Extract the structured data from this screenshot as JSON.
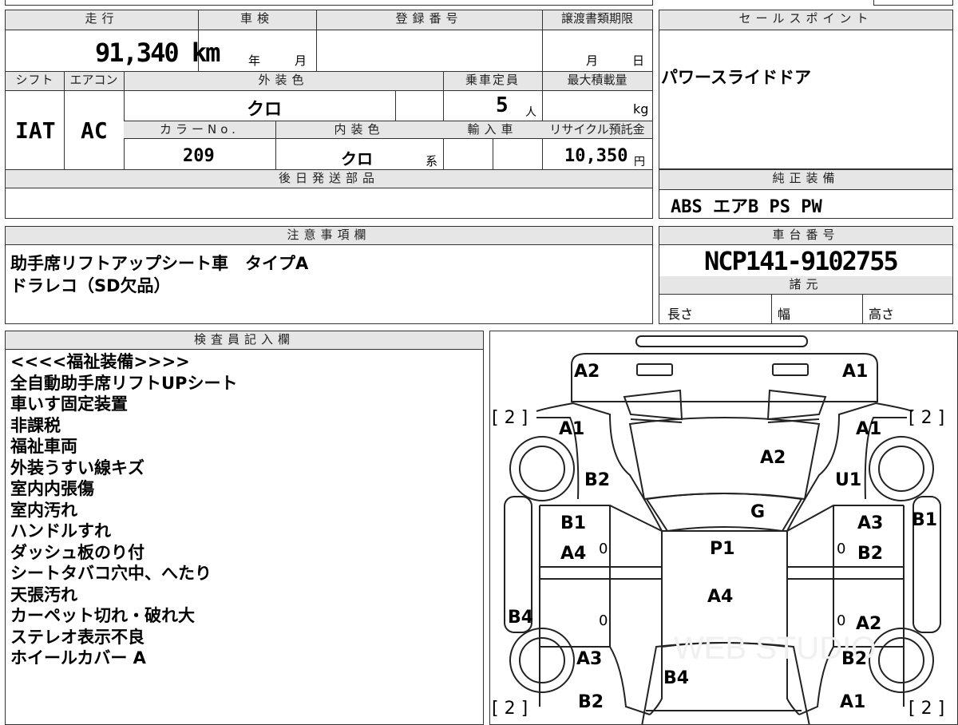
{
  "top": {
    "mileage_label": "走行",
    "mileage_value": "91,340 km",
    "inspection_label": "車検",
    "inspection_year_unit": "年",
    "inspection_month_unit": "月",
    "reg_number_label": "登録番号",
    "transfer_deadline_label": "譲渡書類期限",
    "transfer_month_unit": "月",
    "transfer_day_unit": "日",
    "shift_label": "シフト",
    "shift_value": "IAT",
    "ac_label": "エアコン",
    "ac_value": "AC",
    "exterior_color_label": "外装色",
    "exterior_color_value": "クロ",
    "capacity_label": "乗車定員",
    "capacity_value": "5",
    "capacity_unit": "人",
    "max_load_label": "最大積載量",
    "max_load_unit": "kg",
    "color_no_label": "カラーNo.",
    "color_no_value": "209",
    "interior_color_label": "内装色",
    "interior_color_value": "クロ",
    "interior_color_suffix": "系",
    "import_label": "輸入車",
    "recycle_label": "リサイクル預託金",
    "recycle_value": "10,350",
    "recycle_unit": "円",
    "later_parts_label": "後日発送部品"
  },
  "sales_point": {
    "label": "セールスポイント",
    "text": "パワースライドドア"
  },
  "equipment": {
    "label": "純正装備",
    "text": "ABS エアB PS PW"
  },
  "notes": {
    "label": "注意事項欄",
    "lines": [
      "助手席リフトアップシート車　タイプA",
      "ドラレコ（SD欠品）"
    ]
  },
  "chassis": {
    "label": "車台番号",
    "value": "NCP141-9102755",
    "spec_label": "諸元",
    "length_label": "長さ",
    "width_label": "幅",
    "height_label": "高さ"
  },
  "inspector": {
    "label": "検査員記入欄",
    "lines": [
      "<<<<福祉装備>>>>",
      "全自動助手席リフトUPシート",
      "車いす固定装置",
      "非課税",
      "福祉車両",
      "外装うすい線キズ",
      "室内内張傷",
      "室内汚れ",
      "ハンドルすれ",
      "ダッシュ板のり付",
      "シートタバコ穴中、へたり",
      "天張汚れ",
      "カーペット切れ・破れ大",
      "ステレオ表示不良",
      "ホイールカバー A"
    ]
  },
  "diagram": {
    "tire_tl": "[ 2 ]",
    "tire_tr": "[ 2 ]",
    "tire_bl": "[ 2 ]",
    "tire_br": "[ 2 ]",
    "marks": {
      "front_bumper_left": "A2",
      "front_bumper_right": "A1",
      "front_fender_left": "A1",
      "front_fender_right": "A1",
      "hood": "A2",
      "left_fender_lower": "B2",
      "right_fender_lower": "U1",
      "windshield": "G",
      "left_front_door_upper": "B1",
      "left_front_door_lower": "A4",
      "right_front_door_upper": "A3",
      "right_front_door_lower": "B2",
      "right_pillar": "B1",
      "roof": "P1",
      "roof_rear": "A4",
      "left_rocker": "B4",
      "right_rear_door": "A2",
      "left_quarter": "A3",
      "right_quarter": "B2",
      "rear_gate": "B4",
      "rear_bumper_left": "B2",
      "rear_bumper_right": "A1",
      "zero_1": "0",
      "zero_2": "0",
      "zero_3": "0",
      "zero_4": "0"
    }
  }
}
